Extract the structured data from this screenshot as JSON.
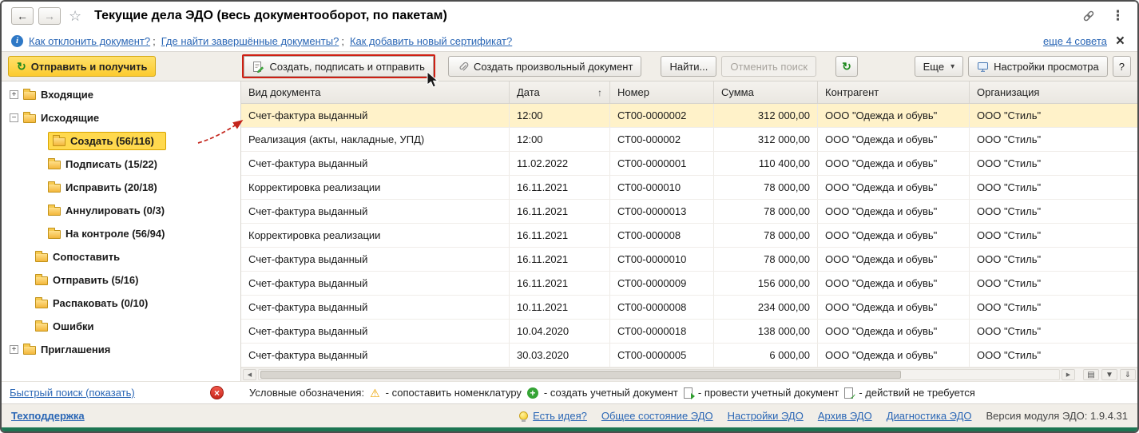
{
  "window": {
    "title": "Текущие дела ЭДО (весь документооборот, по пакетам)"
  },
  "tips": {
    "links": [
      {
        "label": "Как отклонить документ?"
      },
      {
        "label": "Где найти завершённые документы?"
      },
      {
        "label": "Как добавить новый сертификат?"
      }
    ],
    "separator": ";",
    "more": "еще 4 совета"
  },
  "toolbar": {
    "send_receive": "Отправить и получить",
    "create_sign_send": "Создать, подписать и отправить",
    "create_arbitrary": "Создать произвольный документ",
    "find": "Найти...",
    "cancel_search": "Отменить поиск",
    "more": "Еще",
    "view_settings": "Настройки просмотра",
    "help": "?"
  },
  "sidebar": {
    "items": [
      {
        "label": "Входящие"
      },
      {
        "label": "Исходящие"
      },
      {
        "label": "Создать (56/116)",
        "selected": true
      },
      {
        "label": "Подписать (15/22)"
      },
      {
        "label": "Исправить (20/18)"
      },
      {
        "label": "Аннулировать (0/3)"
      },
      {
        "label": "На контроле (56/94)"
      },
      {
        "label": "Сопоставить"
      },
      {
        "label": "Отправить (5/16)"
      },
      {
        "label": "Распаковать (0/10)"
      },
      {
        "label": "Ошибки"
      },
      {
        "label": "Приглашения"
      }
    ],
    "quick_search": "Быстрый поиск (показать)"
  },
  "table": {
    "columns": [
      "Вид документа",
      "Дата",
      "Номер",
      "Сумма",
      "Контрагент",
      "Организация"
    ],
    "sort_arrow": "↑",
    "rows": [
      [
        "Счет-фактура выданный",
        "12:00",
        "СТ00-0000002",
        "312 000,00",
        "ООО \"Одежда и обувь\"",
        "ООО \"Стиль\""
      ],
      [
        "Реализация (акты, накладные, УПД)",
        "12:00",
        "СТ00-000002",
        "312 000,00",
        "ООО \"Одежда и обувь\"",
        "ООО \"Стиль\""
      ],
      [
        "Счет-фактура выданный",
        "11.02.2022",
        "СТ00-0000001",
        "110 400,00",
        "ООО \"Одежда и обувь\"",
        "ООО \"Стиль\""
      ],
      [
        "Корректировка реализации",
        "16.11.2021",
        "СТ00-000010",
        "78 000,00",
        "ООО \"Одежда и обувь\"",
        "ООО \"Стиль\""
      ],
      [
        "Счет-фактура выданный",
        "16.11.2021",
        "СТ00-0000013",
        "78 000,00",
        "ООО \"Одежда и обувь\"",
        "ООО \"Стиль\""
      ],
      [
        "Корректировка реализации",
        "16.11.2021",
        "СТ00-000008",
        "78 000,00",
        "ООО \"Одежда и обувь\"",
        "ООО \"Стиль\""
      ],
      [
        "Счет-фактура выданный",
        "16.11.2021",
        "СТ00-0000010",
        "78 000,00",
        "ООО \"Одежда и обувь\"",
        "ООО \"Стиль\""
      ],
      [
        "Счет-фактура выданный",
        "16.11.2021",
        "СТ00-0000009",
        "156 000,00",
        "ООО \"Одежда и обувь\"",
        "ООО \"Стиль\""
      ],
      [
        "Счет-фактура выданный",
        "10.11.2021",
        "СТ00-0000008",
        "234 000,00",
        "ООО \"Одежда и обувь\"",
        "ООО \"Стиль\""
      ],
      [
        "Счет-фактура выданный",
        "10.04.2020",
        "СТ00-0000018",
        "138 000,00",
        "ООО \"Одежда и обувь\"",
        "ООО \"Стиль\""
      ],
      [
        "Счет-фактура выданный",
        "30.03.2020",
        "СТ00-0000005",
        "6 000,00",
        "ООО \"Одежда и обувь\"",
        "ООО \"Стиль\""
      ]
    ]
  },
  "legend": {
    "title": "Условные обозначения:",
    "items": [
      {
        "icon": "warning-icon",
        "text": "- сопоставить номенклатуру"
      },
      {
        "icon": "create-doc-icon",
        "text": "- создать учетный документ"
      },
      {
        "icon": "post-doc-icon",
        "text": "- провести учетный документ"
      },
      {
        "icon": "no-action-icon",
        "text": "- действий не требуется"
      }
    ]
  },
  "footer": {
    "support": "Техподдержка",
    "idea": "Есть идея?",
    "links": [
      "Общее состояние ЭДО",
      "Настройки ЭДО",
      "Архив ЭДО",
      "Диагностика ЭДО"
    ],
    "version": "Версия модуля ЭДО: 1.9.4.31"
  },
  "icons": {
    "back": "←",
    "forward": "→",
    "star": "☆",
    "dots": "⋮",
    "info": "i",
    "close": "×",
    "refresh": "↻",
    "caret_down": "▾",
    "expand": "+",
    "collapse_tree": "−",
    "scroll_left": "◀",
    "scroll_right": "▶",
    "grid": "▤",
    "chevron_down": "▼",
    "double_down": "⇓",
    "warning": "⚠",
    "plus": "+"
  }
}
